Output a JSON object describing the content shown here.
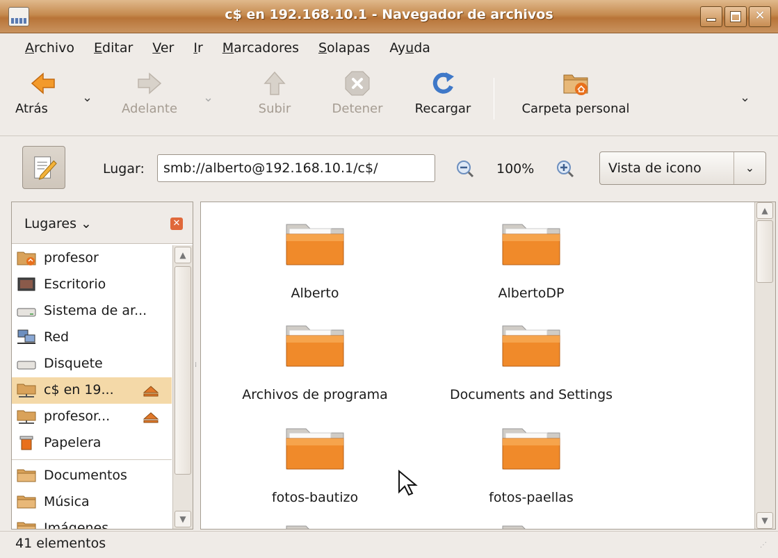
{
  "window": {
    "title": "c$ en 192.168.10.1 - Navegador de archivos"
  },
  "menubar": {
    "items": [
      {
        "pre": "",
        "mnemonic": "A",
        "post": "rchivo"
      },
      {
        "pre": "",
        "mnemonic": "E",
        "post": "ditar"
      },
      {
        "pre": "",
        "mnemonic": "V",
        "post": "er"
      },
      {
        "pre": "",
        "mnemonic": "I",
        "post": "r"
      },
      {
        "pre": "",
        "mnemonic": "M",
        "post": "arcadores"
      },
      {
        "pre": "",
        "mnemonic": "S",
        "post": "olapas"
      },
      {
        "pre": "Ay",
        "mnemonic": "u",
        "post": "da"
      }
    ]
  },
  "toolbar": {
    "back": "Atrás",
    "forward": "Adelante",
    "up": "Subir",
    "stop": "Detener",
    "reload": "Recargar",
    "home": "Carpeta personal"
  },
  "location": {
    "label": "Lugar:",
    "value": "smb://alberto@192.168.10.1/c$/",
    "zoom": "100%",
    "view_mode": "Vista de icono"
  },
  "sidebar": {
    "title": "Lugares",
    "items": [
      {
        "label": "profesor",
        "icon": "home-folder-icon"
      },
      {
        "label": "Escritorio",
        "icon": "desktop-icon"
      },
      {
        "label": "Sistema de ar...",
        "icon": "filesystem-icon"
      },
      {
        "label": "Red",
        "icon": "network-icon"
      },
      {
        "label": "Disquete",
        "icon": "floppy-icon"
      },
      {
        "label": "c$ en 19...",
        "icon": "network-share-icon",
        "selected": true,
        "eject": true
      },
      {
        "label": "profesor...",
        "icon": "network-share-icon",
        "eject": true
      },
      {
        "label": "Papelera",
        "icon": "trash-icon"
      },
      {
        "label": "Documentos",
        "icon": "folder-icon"
      },
      {
        "label": "Música",
        "icon": "folder-icon"
      },
      {
        "label": "Imágenes",
        "icon": "folder-icon"
      }
    ]
  },
  "files": [
    {
      "name": "Alberto"
    },
    {
      "name": "AlbertoDP"
    },
    {
      "name": "Archivos de programa"
    },
    {
      "name": "Documents and Settings"
    },
    {
      "name": "fotos-bautizo"
    },
    {
      "name": "fotos-paellas"
    }
  ],
  "status": {
    "text": "41 elementos"
  },
  "colors": {
    "title_bar": "#c58a4f",
    "folder_orange": "#f08a2a",
    "selection": "#f4d9a8"
  }
}
